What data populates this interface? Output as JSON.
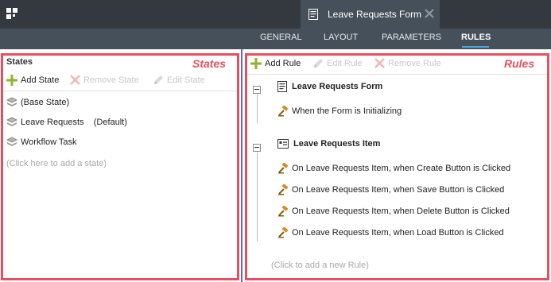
{
  "header": {
    "doc_tab_title": "Leave Requests Form",
    "tabs": [
      "GENERAL",
      "LAYOUT",
      "PARAMETERS",
      "RULES"
    ],
    "active_tab": "RULES"
  },
  "states_panel": {
    "overlay_label": "States",
    "title": "States",
    "toolbar": {
      "add": "Add State",
      "remove": "Remove State",
      "edit": "Edit State"
    },
    "items": [
      "(Base State)",
      "Leave Requests    (Default)",
      "Workflow Task"
    ],
    "add_hint": "(Click here to add a state)"
  },
  "rules_panel": {
    "overlay_label": "Rules",
    "toolbar": {
      "add": "Add Rule",
      "edit": "Edit Rule",
      "remove": "Remove Rule"
    },
    "groups": [
      {
        "title": "Leave Requests Form",
        "rules": [
          "When the Form is Initializing"
        ]
      },
      {
        "title": "Leave Requests Item",
        "rules": [
          "On Leave Requests Item, when Create Button is Clicked",
          "On Leave Requests Item, when Save Button is Clicked",
          "On Leave Requests Item, when Delete Button is Clicked",
          "On Leave Requests Item, when Load Button is Clicked"
        ]
      }
    ],
    "add_hint": "(Click to add a new Rule)"
  },
  "colors": {
    "header_dark": "#34393f",
    "header_nav": "#46505a",
    "accent_blue": "#49a6df",
    "annotation_red": "#e94e5e",
    "divider_blue": "#5b6dbf"
  },
  "icons": [
    "app-grid-icon",
    "document-icon",
    "close-icon",
    "plus-icon",
    "x-icon",
    "pencil-icon",
    "layers-icon",
    "gavel-icon",
    "form-icon",
    "list-item-icon"
  ]
}
